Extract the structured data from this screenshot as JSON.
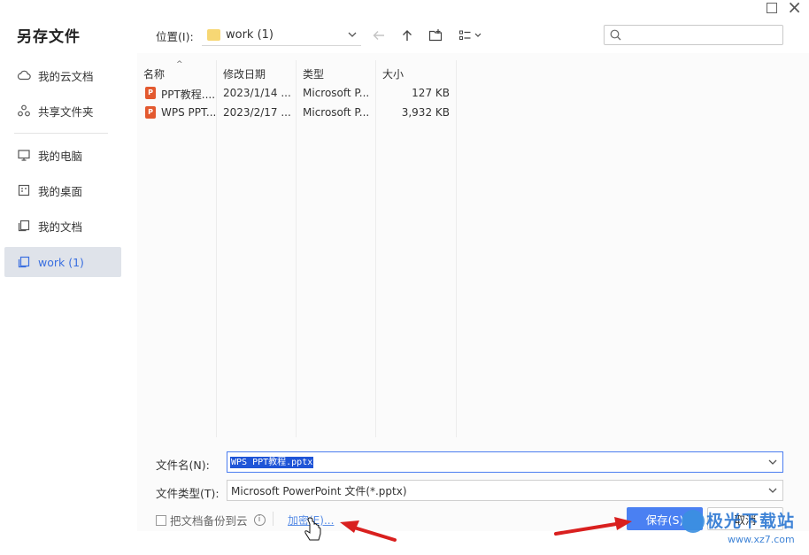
{
  "dialog": {
    "title": "另存文件"
  },
  "sidebar": {
    "items": [
      {
        "label": "我的云文档",
        "icon": "cloud-icon"
      },
      {
        "label": "共享文件夹",
        "icon": "share-folder-icon"
      },
      {
        "label": "我的电脑",
        "icon": "computer-icon"
      },
      {
        "label": "我的桌面",
        "icon": "desktop-icon"
      },
      {
        "label": "我的文档",
        "icon": "documents-icon"
      },
      {
        "label": "work (1)",
        "icon": "folder-icon",
        "active": true
      }
    ]
  },
  "toolbar": {
    "location_label": "位置(I):",
    "location_value": "work (1)",
    "search_placeholder": ""
  },
  "filelist": {
    "columns": [
      "名称",
      "修改日期",
      "类型",
      "大小"
    ],
    "rows": [
      {
        "name": "PPT教程....",
        "date": "2023/1/14 ...",
        "type": "Microsoft P...",
        "size": "127 KB"
      },
      {
        "name": "WPS PPT...",
        "date": "2023/2/17 ...",
        "type": "Microsoft P...",
        "size": "3,932 KB"
      }
    ]
  },
  "form": {
    "filename_label": "文件名(N):",
    "filename_value": "WPS PPT教程.pptx",
    "filetype_label": "文件类型(T):",
    "filetype_value": "Microsoft PowerPoint 文件(*.pptx)",
    "backup_label": "把文档备份到云",
    "encrypt_label": "加密(E)...",
    "save_label": "保存(S)",
    "cancel_label": "取消"
  },
  "watermark": {
    "text": "极光下载站",
    "url": "www.xz7.com"
  },
  "colors": {
    "accent": "#4a80f2",
    "sidebar_active_bg": "#dfe3ea",
    "arrow": "#d9201f"
  }
}
